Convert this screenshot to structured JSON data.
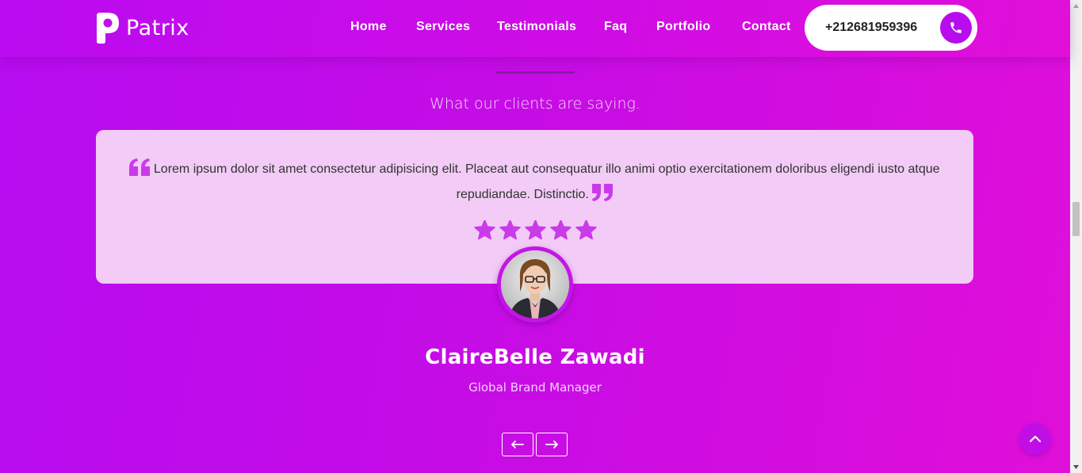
{
  "brand": {
    "name": "Patrix"
  },
  "nav": {
    "items": [
      {
        "label": "Home"
      },
      {
        "label": "Services"
      },
      {
        "label": "Testimonials"
      },
      {
        "label": "Faq"
      },
      {
        "label": "Portfolio"
      },
      {
        "label": "Contact"
      }
    ],
    "phone": "+212681959396"
  },
  "testimonials": {
    "subtitle": "What our clients are saying.",
    "quote": "Lorem ipsum dolor sit amet consectetur adipisicing elit. Placeat aut consequatur illo animi optio exercitationem doloribus eligendi iusto atque repudiandae. Distinctio.",
    "rating": 5,
    "name": "ClaireBelle Zawadi",
    "role": "Global Brand Manager"
  },
  "colors": {
    "accent": "#b80cee",
    "star": "#c93be9",
    "card_bg": "#f2cbf6"
  },
  "icons": {
    "phone": "phone-icon",
    "prev": "arrow-left-icon",
    "next": "arrow-right-icon",
    "to_top": "chevron-up-icon",
    "star": "star-icon",
    "quote_open": "quote-open-icon",
    "quote_close": "quote-close-icon"
  }
}
